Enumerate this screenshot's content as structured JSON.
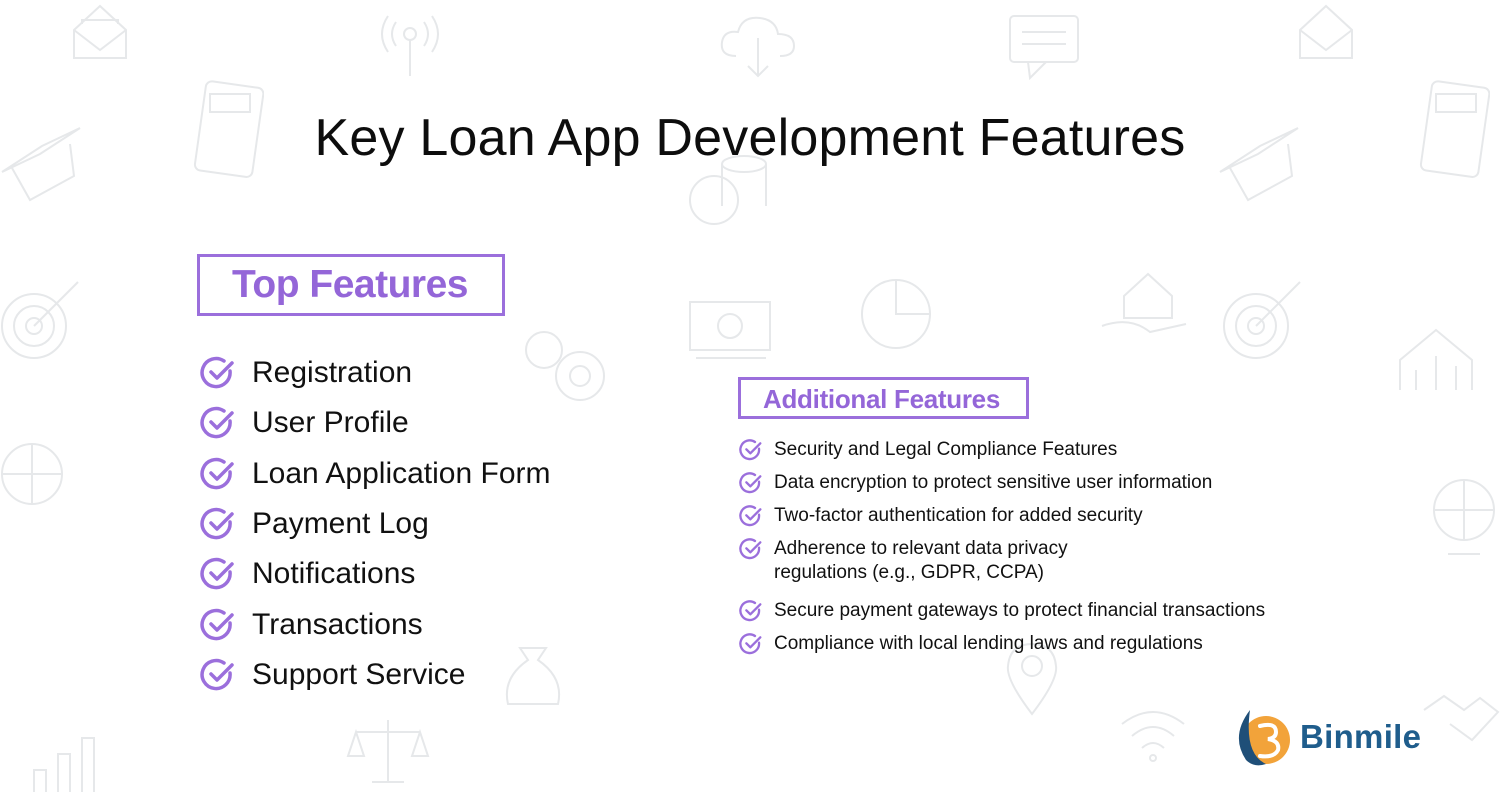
{
  "title": "Key Loan App Development Features",
  "top_features": {
    "heading": "Top Features",
    "items": [
      "Registration",
      "User Profile",
      "Loan Application Form",
      "Payment Log",
      "Notifications",
      "Transactions",
      "Support Service"
    ]
  },
  "additional_features": {
    "heading": "Additional Features",
    "items": [
      "Security and Legal Compliance Features",
      "Data encryption to protect sensitive user information",
      "Two-factor authentication for added security",
      "Adherence to relevant data privacy regulations (e.g., GDPR, CCPA)",
      "Secure payment gateways to protect financial transactions",
      "Compliance with local lending laws and regulations"
    ]
  },
  "brand": {
    "name": "Binmile",
    "accent": "#9466d8",
    "logo_blue": "#1f5d8c",
    "logo_orange": "#f2a33a"
  },
  "icons": {
    "check": "check-circle-icon",
    "background": [
      "envelope-icon",
      "antenna-icon",
      "cloud-download-icon",
      "chat-icon",
      "calculator-icon",
      "graduation-cap-icon",
      "coins-icon",
      "target-icon",
      "gear-icon",
      "money-icon",
      "pie-chart-icon",
      "house-hand-icon",
      "chart-icon",
      "globe-icon",
      "money-bag-icon",
      "location-pin-icon",
      "wifi-icon",
      "scale-icon",
      "gavel-icon",
      "handshake-icon"
    ]
  }
}
